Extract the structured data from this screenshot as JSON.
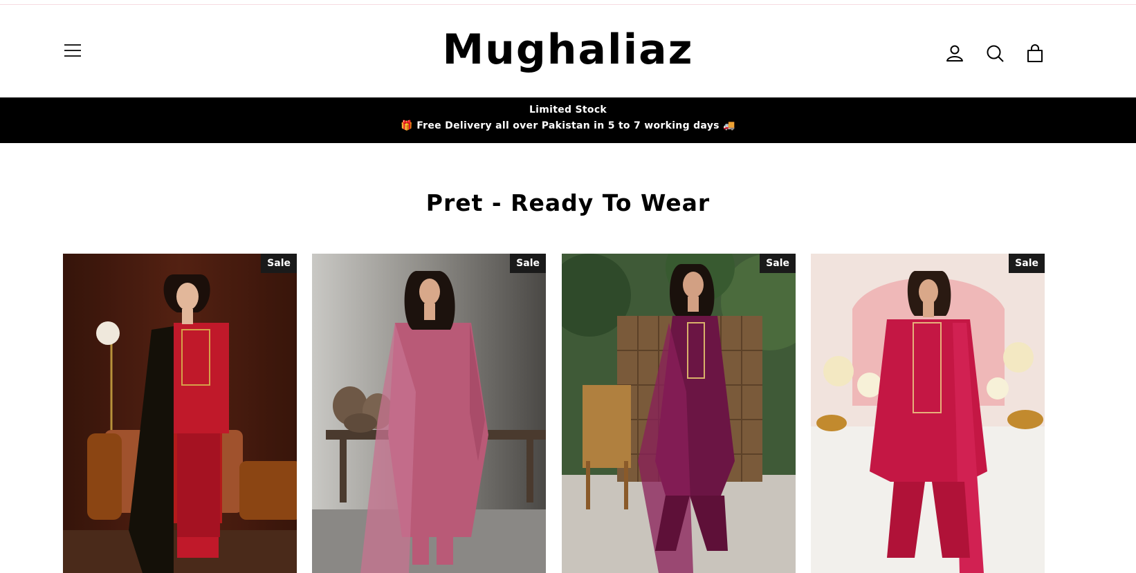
{
  "header": {
    "logo": "Mughaliaz",
    "menu_icon": "hamburger-menu-icon",
    "account_icon": "user-icon",
    "search_icon": "search-icon",
    "cart_icon": "shopping-bag-icon"
  },
  "announcement": {
    "line1": "Limited Stock",
    "line2": "🎁 Free Delivery all over Pakistan in 5 to 7 working days 🚚"
  },
  "collection": {
    "title": "Pret - Ready To Wear",
    "products": [
      {
        "badge": "Sale"
      },
      {
        "badge": "Sale"
      },
      {
        "badge": "Sale"
      },
      {
        "badge": "Sale"
      }
    ]
  },
  "colors": {
    "announcement_bg": "#000000",
    "badge_bg": "#1a1a1a",
    "text": "#000000"
  }
}
